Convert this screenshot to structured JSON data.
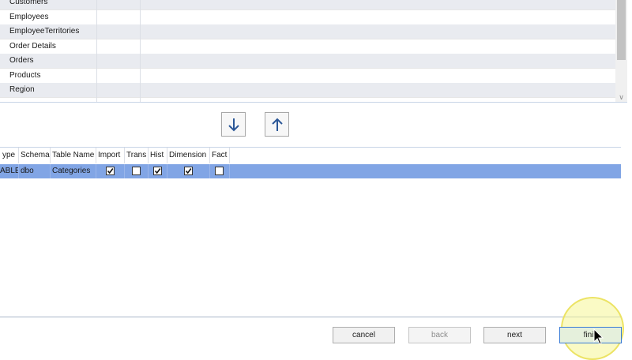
{
  "source_tables": {
    "rows": [
      {
        "name": "Customers"
      },
      {
        "name": "Employees"
      },
      {
        "name": "EmployeeTerritories"
      },
      {
        "name": "Order Details"
      },
      {
        "name": "Orders"
      },
      {
        "name": "Products"
      },
      {
        "name": "Region"
      }
    ],
    "scroll_arrow_icon": "chevron-down-icon"
  },
  "move_buttons": {
    "down_icon": "arrow-down-icon",
    "up_icon": "arrow-up-icon",
    "icon_color": "#2b5797"
  },
  "selected_tables": {
    "columns": [
      "ype",
      "Schema",
      "Table Name",
      "Import",
      "Trans",
      "Hist",
      "Dimension",
      "Fact"
    ],
    "rows": [
      {
        "type": "ABLE",
        "schema": "dbo",
        "table_name": "Categories",
        "import": true,
        "trans": false,
        "hist": true,
        "dimension": true,
        "fact": false
      }
    ],
    "selection_color": "#81a5e5"
  },
  "footer": {
    "cancel_label": "cancel",
    "back_label": "back",
    "next_label": "next",
    "finish_label": "finis"
  }
}
